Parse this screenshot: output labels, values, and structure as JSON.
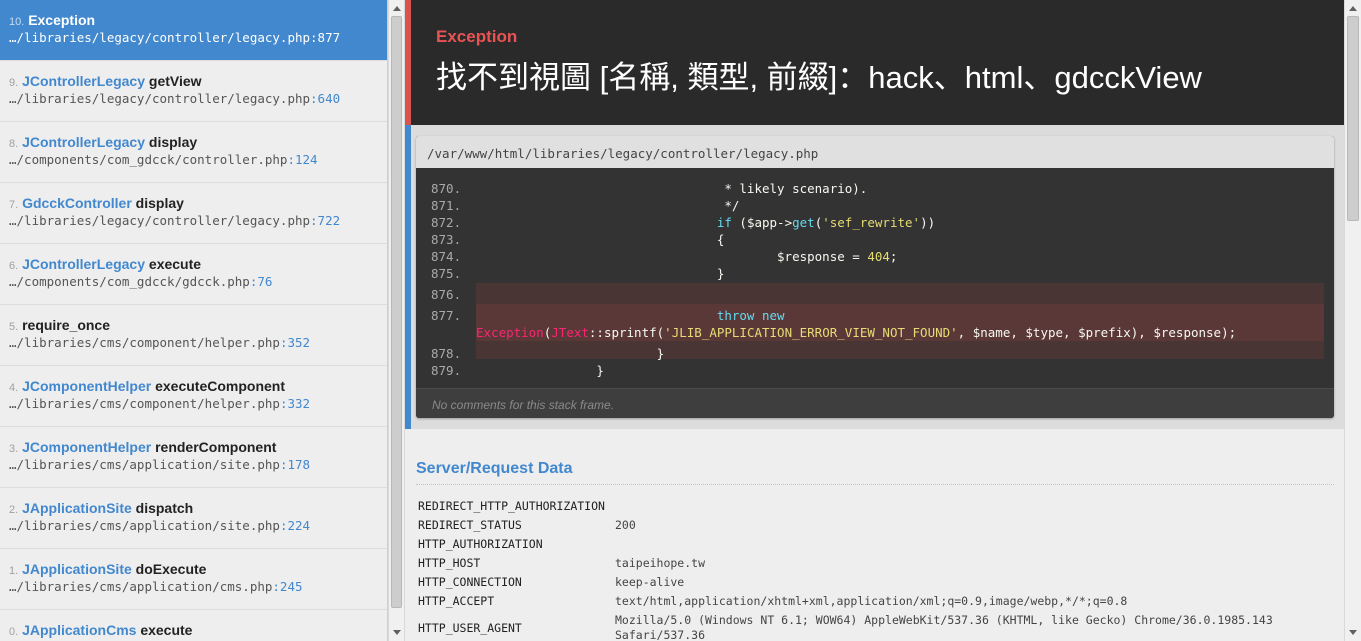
{
  "frames": [
    {
      "index": "10.",
      "cls": "",
      "fn": "Exception",
      "path": "…/libraries/legacy/controller/legacy.php",
      "line": ":877",
      "active": true
    },
    {
      "index": "9.",
      "cls": "JControllerLegacy",
      "fn": "getView",
      "path": "…/libraries/legacy/controller/legacy.php",
      "line": ":640"
    },
    {
      "index": "8.",
      "cls": "JControllerLegacy",
      "fn": "display",
      "path": "…/components/com_gdcck/controller.php",
      "line": ":124"
    },
    {
      "index": "7.",
      "cls": "GdcckController",
      "fn": "display",
      "path": "…/libraries/legacy/controller/legacy.php",
      "line": ":722"
    },
    {
      "index": "6.",
      "cls": "JControllerLegacy",
      "fn": "execute",
      "path": "…/components/com_gdcck/gdcck.php",
      "line": ":76"
    },
    {
      "index": "5.",
      "cls": "",
      "fn": "require_once",
      "path": "…/libraries/cms/component/helper.php",
      "line": ":352"
    },
    {
      "index": "4.",
      "cls": "JComponentHelper",
      "fn": "executeComponent",
      "path": "…/libraries/cms/component/helper.php",
      "line": ":332"
    },
    {
      "index": "3.",
      "cls": "JComponentHelper",
      "fn": "renderComponent",
      "path": "…/libraries/cms/application/site.php",
      "line": ":178"
    },
    {
      "index": "2.",
      "cls": "JApplicationSite",
      "fn": "dispatch",
      "path": "…/libraries/cms/application/site.php",
      "line": ":224"
    },
    {
      "index": "1.",
      "cls": "JApplicationSite",
      "fn": "doExecute",
      "path": "…/libraries/cms/application/cms.php",
      "line": ":245"
    },
    {
      "index": "0.",
      "cls": "JApplicationCms",
      "fn": "execute",
      "path": "",
      "line": ""
    }
  ],
  "exception": {
    "label": "Exception",
    "message": "找不到視圖 [名稱, 類型, 前綴]：hack、html、gdcckView"
  },
  "code": {
    "path": "/var/www/html/libraries/legacy/controller/legacy.php",
    "lines": [
      {
        "no": "870.",
        "parts": [
          {
            "t": "                                 * likely scenario)."
          }
        ]
      },
      {
        "no": "871.",
        "parts": [
          {
            "t": "                                 */"
          }
        ]
      },
      {
        "no": "872.",
        "parts": [
          {
            "t": "                                "
          },
          {
            "t": "if",
            "c": "kw"
          },
          {
            "t": " ($app->"
          },
          {
            "t": "get",
            "c": "fn"
          },
          {
            "t": "("
          },
          {
            "t": "'sef_rewrite'",
            "c": "str"
          },
          {
            "t": "))"
          }
        ]
      },
      {
        "no": "873.",
        "parts": [
          {
            "t": "                                {"
          }
        ]
      },
      {
        "no": "874.",
        "parts": [
          {
            "t": "                                        $response = "
          },
          {
            "t": "404",
            "c": "num"
          },
          {
            "t": ";"
          }
        ]
      },
      {
        "no": "875.",
        "parts": [
          {
            "t": "                                }"
          }
        ]
      },
      {
        "no": "876.",
        "parts": [
          {
            "t": ""
          }
        ]
      },
      {
        "no": "877.",
        "parts": [
          {
            "t": "                                "
          },
          {
            "t": "throw",
            "c": "kw"
          },
          {
            "t": " "
          },
          {
            "t": "new",
            "c": "kw"
          }
        ],
        "cont": [
          {
            "t": "Exception",
            "c": "cls"
          },
          {
            "t": "("
          },
          {
            "t": "JText",
            "c": "cls"
          },
          {
            "t": "::sprintf("
          },
          {
            "t": "'JLIB_APPLICATION_ERROR_VIEW_NOT_FOUND'",
            "c": "str"
          },
          {
            "t": ", $name, $type, $prefix), $response);"
          }
        ]
      },
      {
        "no": "878.",
        "parts": [
          {
            "t": "                        }"
          }
        ]
      },
      {
        "no": "879.",
        "parts": [
          {
            "t": "                }"
          }
        ]
      }
    ],
    "comments": "No comments for this stack frame."
  },
  "server": {
    "title": "Server/Request Data",
    "rows": [
      {
        "k": "REDIRECT_HTTP_AUTHORIZATION",
        "v": ""
      },
      {
        "k": "REDIRECT_STATUS",
        "v": "200"
      },
      {
        "k": "HTTP_AUTHORIZATION",
        "v": ""
      },
      {
        "k": "HTTP_HOST",
        "v": "taipeihope.tw"
      },
      {
        "k": "HTTP_CONNECTION",
        "v": "keep-alive"
      },
      {
        "k": "HTTP_ACCEPT",
        "v": "text/html,application/xhtml+xml,application/xml;q=0.9,image/webp,*/*;q=0.8"
      },
      {
        "k": "HTTP_USER_AGENT",
        "v": "Mozilla/5.0 (Windows NT 6.1; WOW64) AppleWebKit/537.36 (KHTML, like Gecko) Chrome/36.0.1985.143 Safari/537.36"
      }
    ]
  },
  "colors": {
    "accent": "#4288ce",
    "exception_red": "#e95353",
    "header_bg": "#2a2a2a"
  }
}
